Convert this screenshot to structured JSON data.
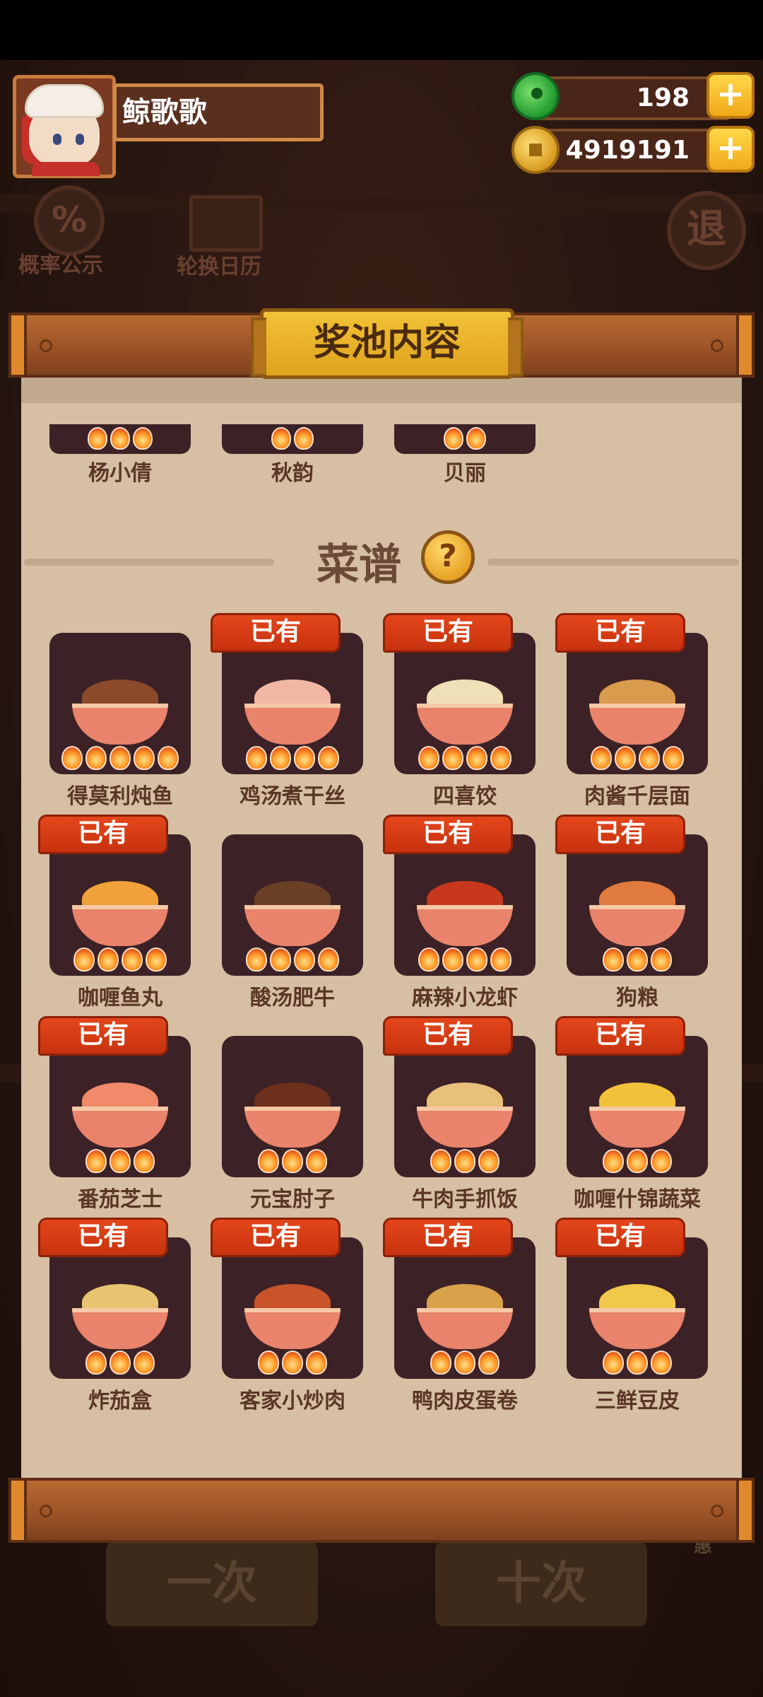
{
  "player": {
    "name": "鲸歌歌"
  },
  "resources": {
    "jade": {
      "value": "198",
      "icon": "jade-orb-icon"
    },
    "coins": {
      "value": "4919191",
      "icon": "coin-icon"
    },
    "plus_label": "+"
  },
  "background": {
    "probability_label": "概率公示",
    "calendar_label": "轮换日历",
    "exit_label": "退",
    "single_draw_label": "一次",
    "ten_draw_label": "十次",
    "discount_label": "九折优惠"
  },
  "panel": {
    "title": "奖池内容",
    "characters": [
      {
        "name": "杨小倩",
        "stars": 3
      },
      {
        "name": "秋韵",
        "stars": 2
      },
      {
        "name": "贝丽",
        "stars": 2
      }
    ],
    "recipes_title": "菜谱",
    "help_label": "?",
    "owned_label": "已有",
    "recipes": [
      {
        "name": "得莫利炖鱼",
        "stars": 5,
        "owned": false,
        "color": "#8b4a2a"
      },
      {
        "name": "鸡汤煮干丝",
        "stars": 4,
        "owned": true,
        "color": "#f1b7a4"
      },
      {
        "name": "四喜饺",
        "stars": 4,
        "owned": true,
        "color": "#efe0b8"
      },
      {
        "name": "肉酱千层面",
        "stars": 4,
        "owned": true,
        "color": "#d99b4e"
      },
      {
        "name": "咖喱鱼丸",
        "stars": 4,
        "owned": true,
        "color": "#f0a13a"
      },
      {
        "name": "酸汤肥牛",
        "stars": 4,
        "owned": false,
        "color": "#6a4026"
      },
      {
        "name": "麻辣小龙虾",
        "stars": 4,
        "owned": true,
        "color": "#c8381f"
      },
      {
        "name": "狗粮",
        "stars": 3,
        "owned": true,
        "color": "#e07a3e"
      },
      {
        "name": "番茄芝士",
        "stars": 3,
        "owned": true,
        "color": "#f08a6a"
      },
      {
        "name": "元宝肘子",
        "stars": 3,
        "owned": false,
        "color": "#6e2f1c"
      },
      {
        "name": "牛肉手抓饭",
        "stars": 3,
        "owned": true,
        "color": "#e8c07a"
      },
      {
        "name": "咖喱什锦蔬菜",
        "stars": 3,
        "owned": true,
        "color": "#f3c23a"
      },
      {
        "name": "炸茄盒",
        "stars": 3,
        "owned": true,
        "color": "#e8c470"
      },
      {
        "name": "客家小炒肉",
        "stars": 3,
        "owned": true,
        "color": "#c9542a"
      },
      {
        "name": "鸭肉皮蛋卷",
        "stars": 3,
        "owned": true,
        "color": "#d9a24a"
      },
      {
        "name": "三鲜豆皮",
        "stars": 3,
        "owned": true,
        "color": "#f0c84a"
      }
    ]
  }
}
